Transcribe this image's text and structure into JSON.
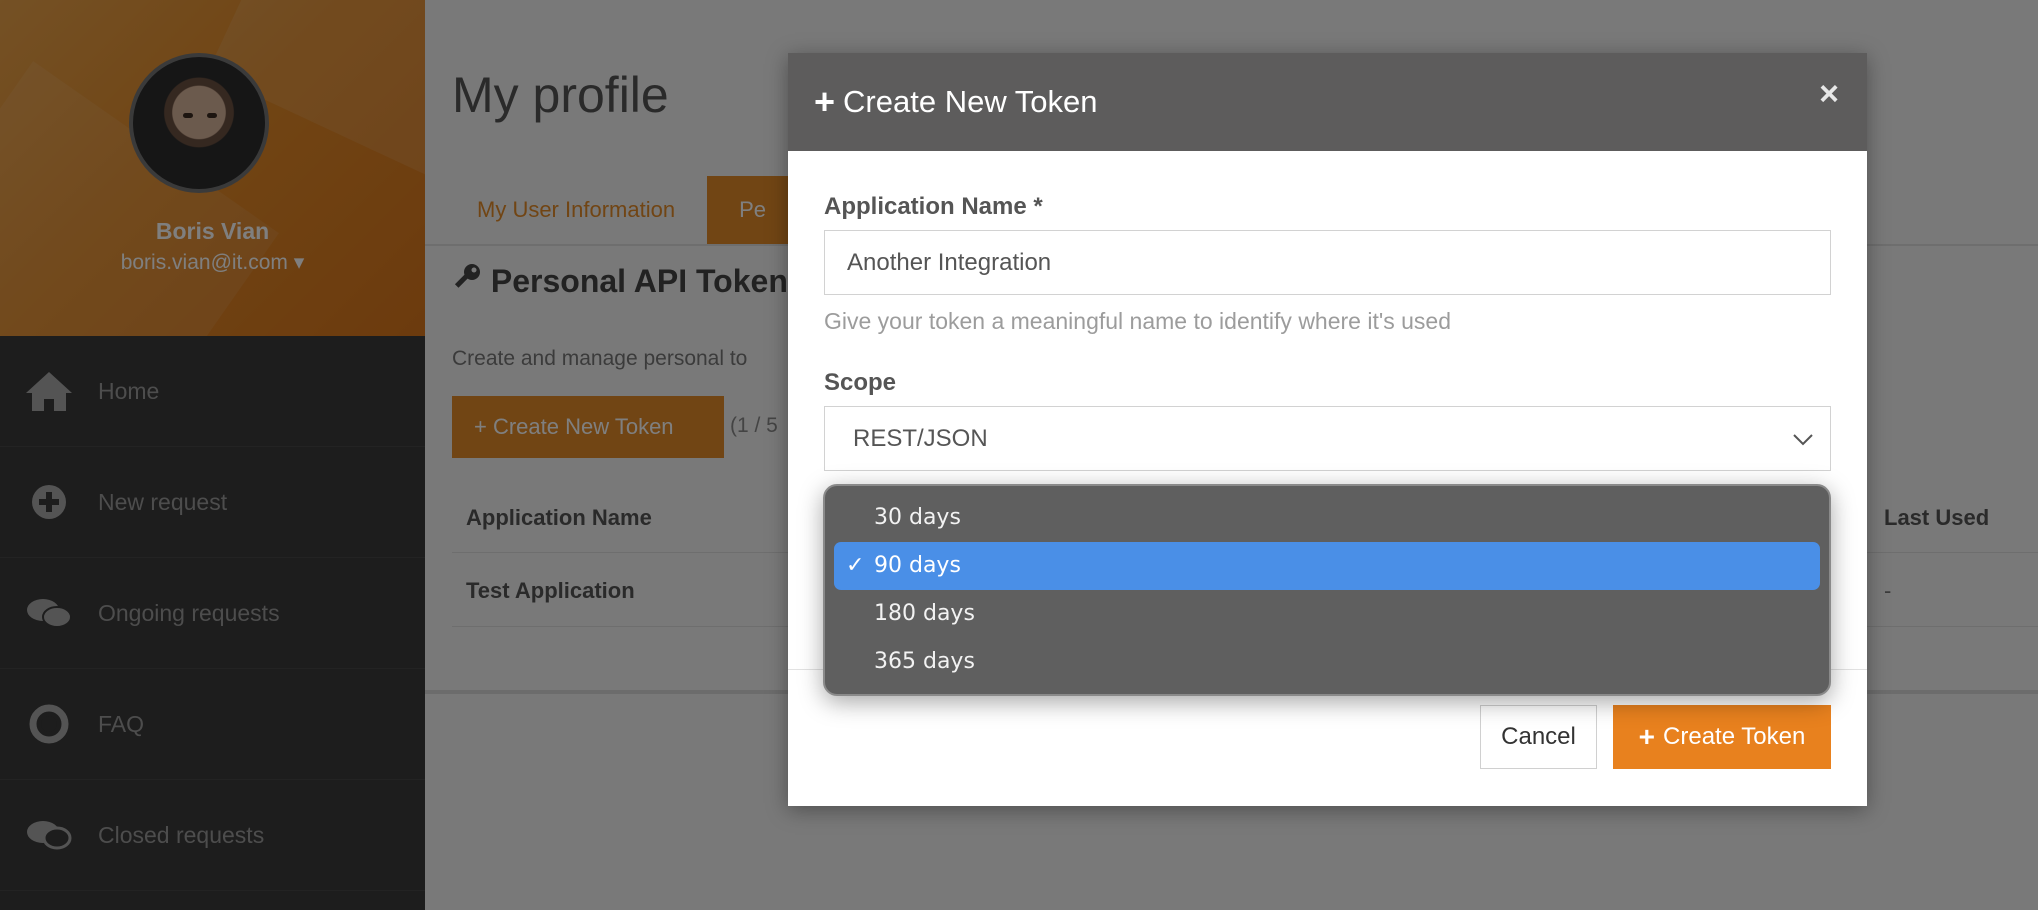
{
  "sidebar": {
    "user_name": "Boris Vian",
    "user_email": "boris.vian@it.com",
    "email_caret": "▾",
    "items": [
      {
        "label": "Home",
        "icon": "home-icon"
      },
      {
        "label": "New request",
        "icon": "plus-circle-icon"
      },
      {
        "label": "Ongoing requests",
        "icon": "chat-bubbles-icon"
      },
      {
        "label": "FAQ",
        "icon": "lifebuoy-icon"
      },
      {
        "label": "Closed requests",
        "icon": "archived-chat-icon"
      }
    ]
  },
  "page": {
    "title": "My profile",
    "tabs": [
      {
        "label": "My User Information",
        "active": false
      },
      {
        "label": "Pe",
        "active": true
      }
    ],
    "section_title": "Personal API Token",
    "section_desc": "Create and manage personal to",
    "create_button": "+ Create New Token",
    "count": "(1 / 5",
    "table": {
      "headers": [
        "Application Name",
        "Last Used"
      ],
      "rows": [
        [
          "Test Application",
          "-"
        ]
      ]
    }
  },
  "modal": {
    "title": "Create New Token",
    "close": "×",
    "app_name_label": "Application Name *",
    "app_name_value": "Another Integration",
    "app_name_help": "Give your token a meaningful name to identify where it's used",
    "scope_label": "Scope",
    "scope_value": "REST/JSON",
    "cancel": "Cancel",
    "create": "Create Token"
  },
  "dropdown": {
    "options": [
      {
        "label": "30 days",
        "selected": false
      },
      {
        "label": "90 days",
        "selected": true
      },
      {
        "label": "180 days",
        "selected": false
      },
      {
        "label": "365 days",
        "selected": false
      }
    ],
    "check": "✓"
  },
  "colors": {
    "accent": "#e28a28",
    "header": "#5d5c5c",
    "selection": "#4a8fe7"
  }
}
